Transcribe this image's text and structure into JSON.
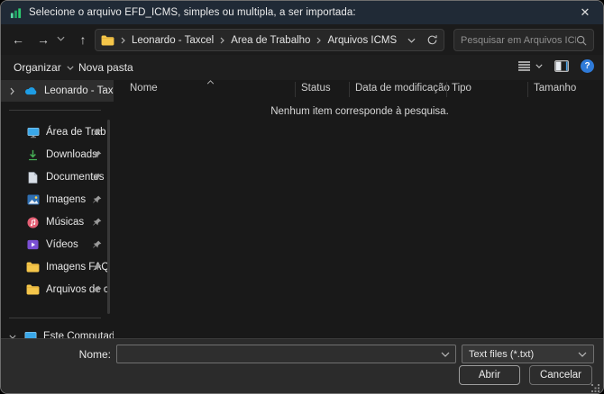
{
  "window": {
    "title": "Selecione o arquivo EFD_ICMS, simples ou multipla, a ser importada:",
    "close_glyph": "✕"
  },
  "nav": {
    "back_glyph": "←",
    "forward_glyph": "→",
    "up_glyph": "↑",
    "breadcrumb": {
      "segments": [
        "Leonardo - Taxcel",
        "Área de Trabalho",
        "Arquivos ICMS"
      ]
    },
    "search_placeholder": "Pesquisar em Arquivos ICMS"
  },
  "command_bar": {
    "organize_label": "Organizar",
    "new_folder_label": "Nova pasta",
    "help_glyph": "?"
  },
  "sidebar": {
    "onedrive": {
      "label": "Leonardo - Taxcel",
      "icon": "onedrive-cloud-icon"
    },
    "items": [
      {
        "label": "Área de Trab",
        "icon": "desktop-icon"
      },
      {
        "label": "Downloads",
        "icon": "downloads-icon"
      },
      {
        "label": "Documentos",
        "icon": "document-icon"
      },
      {
        "label": "Imagens",
        "icon": "pictures-icon"
      },
      {
        "label": "Músicas",
        "icon": "music-icon"
      },
      {
        "label": "Vídeos",
        "icon": "videos-icon"
      },
      {
        "label": "Imagens FAQ",
        "icon": "folder-icon"
      },
      {
        "label": "Arquivos de c",
        "icon": "folder-icon"
      }
    ],
    "this_pc": {
      "label": "Este Computador",
      "icon": "computer-icon"
    }
  },
  "file_list": {
    "columns": [
      "Nome",
      "Status",
      "Data de modificação",
      "Tipo",
      "Tamanho"
    ],
    "empty_message": "Nenhum item corresponde à pesquisa."
  },
  "footer": {
    "filename_label": "Nome:",
    "filename_value": "",
    "filetype_value": "Text files (*.txt)",
    "open_label": "Abrir",
    "cancel_label": "Cancelar"
  },
  "colors": {
    "titlebar": "#202a36",
    "background": "#191919",
    "footer": "#2b2b2b",
    "folder_yellow": "#f5c64a",
    "onedrive_blue": "#1e9de4",
    "help_blue": "#2f7bd9",
    "downloads_green": "#47b257",
    "music_pink": "#e45f74",
    "video_purple": "#7a4fd3",
    "app_icon_green": "#21a366"
  }
}
